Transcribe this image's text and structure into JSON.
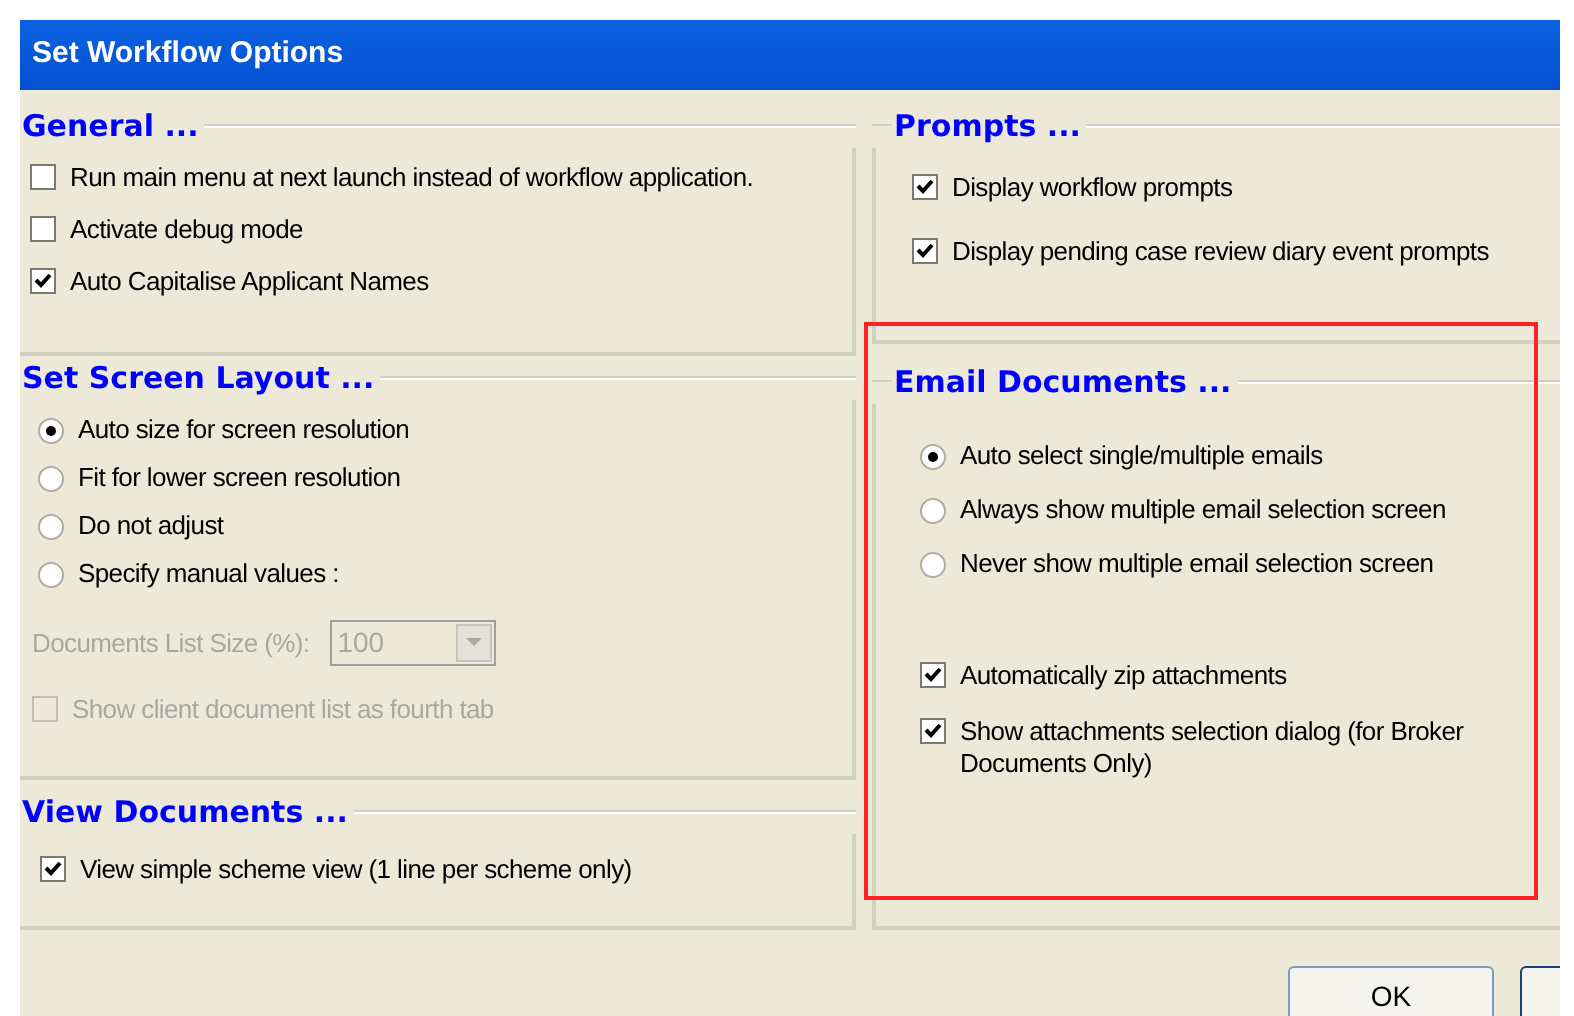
{
  "window": {
    "title": "Set Workflow Options"
  },
  "general": {
    "title": "General ...",
    "options": [
      {
        "label": "Run main menu at next launch instead of workflow application.",
        "checked": false
      },
      {
        "label": "Activate debug mode",
        "checked": false
      },
      {
        "label": "Auto Capitalise Applicant Names",
        "checked": true
      }
    ]
  },
  "screen_layout": {
    "title": "Set Screen Layout ...",
    "options": [
      {
        "label": "Auto size for screen resolution",
        "selected": true
      },
      {
        "label": "Fit for lower screen resolution",
        "selected": false
      },
      {
        "label": "Do not adjust",
        "selected": false
      },
      {
        "label": "Specify manual values :",
        "selected": false
      }
    ],
    "list_size": {
      "label": "Documents List Size (%):",
      "value": "100",
      "disabled": true
    },
    "fourth_tab": {
      "label": "Show client document list as fourth tab",
      "checked": false,
      "disabled": true
    }
  },
  "view_documents": {
    "title": "View Documents ...",
    "options": [
      {
        "label": "View simple scheme view (1 line per scheme only)",
        "checked": true
      }
    ]
  },
  "prompts": {
    "title": "Prompts ...",
    "options": [
      {
        "label": "Display workflow prompts",
        "checked": true
      },
      {
        "label": "Display pending case review diary event prompts",
        "checked": true
      }
    ]
  },
  "email_documents": {
    "title": "Email Documents ...",
    "selection_options": [
      {
        "label": "Auto select single/multiple emails",
        "selected": true
      },
      {
        "label": "Always show multiple email selection screen",
        "selected": false
      },
      {
        "label": "Never show multiple email selection screen",
        "selected": false
      }
    ],
    "attachment_options": [
      {
        "label": "Automatically zip attachments",
        "checked": true
      },
      {
        "label": "Show attachments selection dialog (for Broker Documents Only)",
        "checked": true
      }
    ]
  },
  "buttons": [
    {
      "label": "OK"
    }
  ]
}
